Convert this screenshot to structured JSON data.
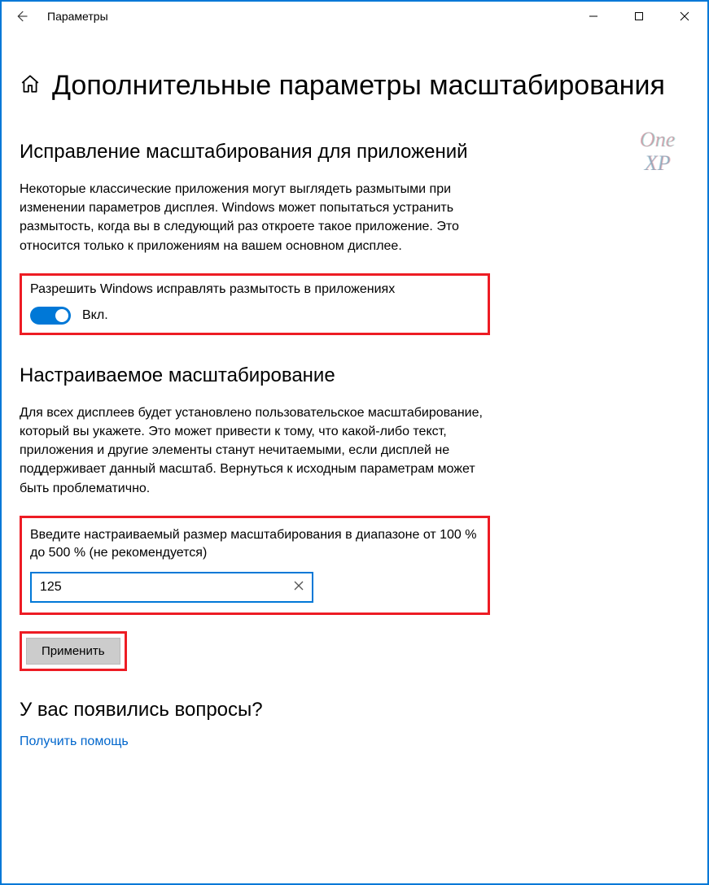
{
  "titlebar": {
    "app_name": "Параметры"
  },
  "page": {
    "title": "Дополнительные параметры масштабирования"
  },
  "section1": {
    "heading": "Исправление масштабирования для приложений",
    "description": "Некоторые классические приложения могут выглядеть размытыми при изменении параметров дисплея. Windows может попытаться устранить размытость, когда вы в следующий раз откроете такое приложение. Это относится только к приложениям на вашем основном дисплее.",
    "toggle_label": "Разрешить Windows исправлять размытость в приложениях",
    "toggle_state": "Вкл."
  },
  "section2": {
    "heading": "Настраиваемое масштабирование",
    "description": "Для всех дисплеев будет установлено пользовательское масштабирование, который вы укажете. Это может привести к тому, что какой-либо текст, приложения и другие элементы станут нечитаемыми, если дисплей не поддерживает данный масштаб. Вернуться к исходным параметрам может быть проблематично.",
    "input_label": "Введите настраиваемый размер масштабирования в диапазоне от 100 % до 500 % (не рекомендуется)",
    "input_value": "125",
    "apply_button": "Применить"
  },
  "help": {
    "heading": "У вас появились вопросы?",
    "link": "Получить помощь"
  },
  "watermark": {
    "line1": "One",
    "line2": "XP"
  }
}
